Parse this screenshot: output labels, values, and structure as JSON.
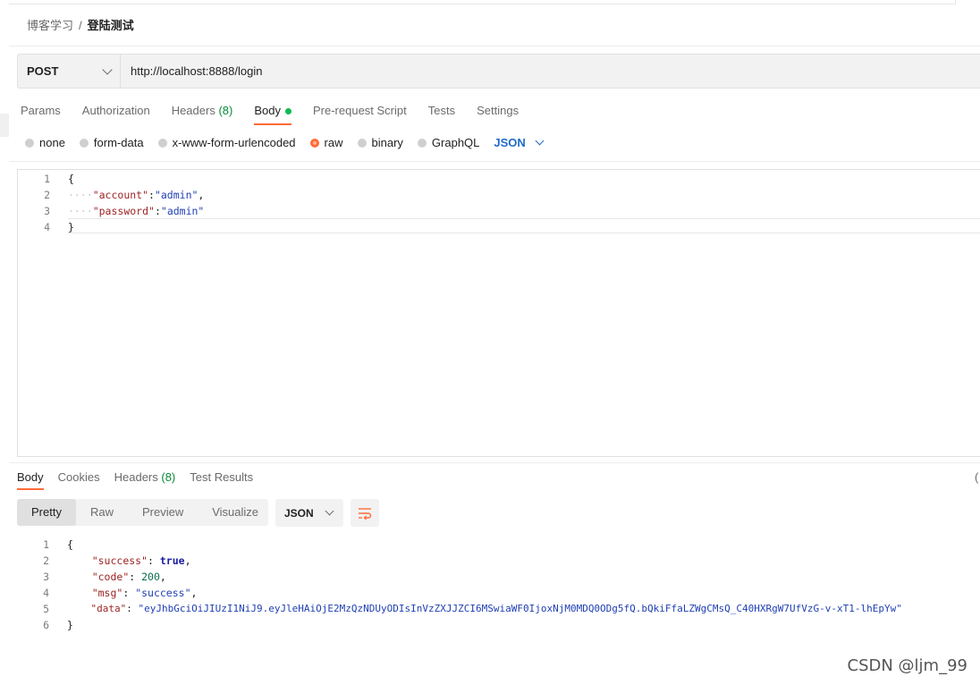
{
  "breadcrumb": {
    "collection": "博客学习",
    "separator": "/",
    "request": "登陆测试"
  },
  "request": {
    "method": "POST",
    "url": "http://localhost:8888/login"
  },
  "request_tabs": [
    {
      "label": "Params"
    },
    {
      "label": "Authorization"
    },
    {
      "label": "Headers",
      "count": "(8)"
    },
    {
      "label": "Body"
    },
    {
      "label": "Pre-request Script"
    },
    {
      "label": "Tests"
    },
    {
      "label": "Settings"
    }
  ],
  "body_modes": {
    "options": [
      "none",
      "form-data",
      "x-www-form-urlencoded",
      "raw",
      "binary",
      "GraphQL"
    ],
    "selected": "raw",
    "format": "JSON"
  },
  "request_body_lines": [
    {
      "n": "1",
      "text": "{"
    },
    {
      "n": "2",
      "key": "\"account\"",
      "value": "\"admin\"",
      "trail": ","
    },
    {
      "n": "3",
      "key": "\"password\"",
      "value": "\"admin\"",
      "trail": ""
    },
    {
      "n": "4",
      "text": "}"
    }
  ],
  "response_tabs": [
    {
      "label": "Body"
    },
    {
      "label": "Cookies"
    },
    {
      "label": "Headers",
      "count": "(8)"
    },
    {
      "label": "Test Results"
    }
  ],
  "response_paren": "(",
  "view_modes": [
    "Pretty",
    "Raw",
    "Preview",
    "Visualize"
  ],
  "response_format": "JSON",
  "response_body_lines": [
    {
      "n": "1",
      "text": "{"
    },
    {
      "n": "2",
      "key": "\"success\"",
      "value": "true",
      "trail": ","
    },
    {
      "n": "3",
      "key": "\"code\"",
      "value": "200",
      "trail": ","
    },
    {
      "n": "4",
      "key": "\"msg\"",
      "value": "\"success\"",
      "trail": ","
    },
    {
      "n": "5",
      "key": "\"data\"",
      "value": "\"eyJhbGciOiJIUzI1NiJ9.eyJleHAiOjE2MzQzNDUyODIsInVzZXJJZCI6MSwiaWF0IjoxNjM0MDQ0ODg5fQ.bQkiFfaLZWgCMsQ_C40HXRgW7UfVzG-v-xT1-lhEpYw\"",
      "trail": ""
    },
    {
      "n": "6",
      "text": "}"
    }
  ],
  "watermark": "CSDN @ljm_99",
  "colors": {
    "accent": "#ff6c37",
    "link": "#1f6ac9",
    "count": "#0a8a3a"
  }
}
